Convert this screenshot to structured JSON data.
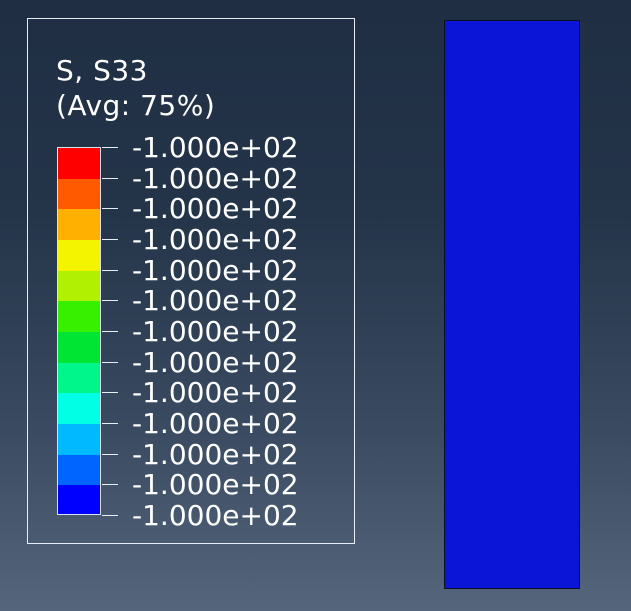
{
  "legend": {
    "title": "S, S33",
    "subtitle": "(Avg: 75%)",
    "colors": [
      "#ff0000",
      "#ff5a00",
      "#ffb000",
      "#f4f400",
      "#b0f000",
      "#36f000",
      "#00e533",
      "#00f68a",
      "#00ffe5",
      "#00b9ff",
      "#0064ff",
      "#0000ff"
    ],
    "labels": [
      "-1.000e+02",
      "-1.000e+02",
      "-1.000e+02",
      "-1.000e+02",
      "-1.000e+02",
      "-1.000e+02",
      "-1.000e+02",
      "-1.000e+02",
      "-1.000e+02",
      "-1.000e+02",
      "-1.000e+02",
      "-1.000e+02",
      "-1.000e+02"
    ]
  },
  "model": {
    "fill_color": "#0a15d8"
  }
}
